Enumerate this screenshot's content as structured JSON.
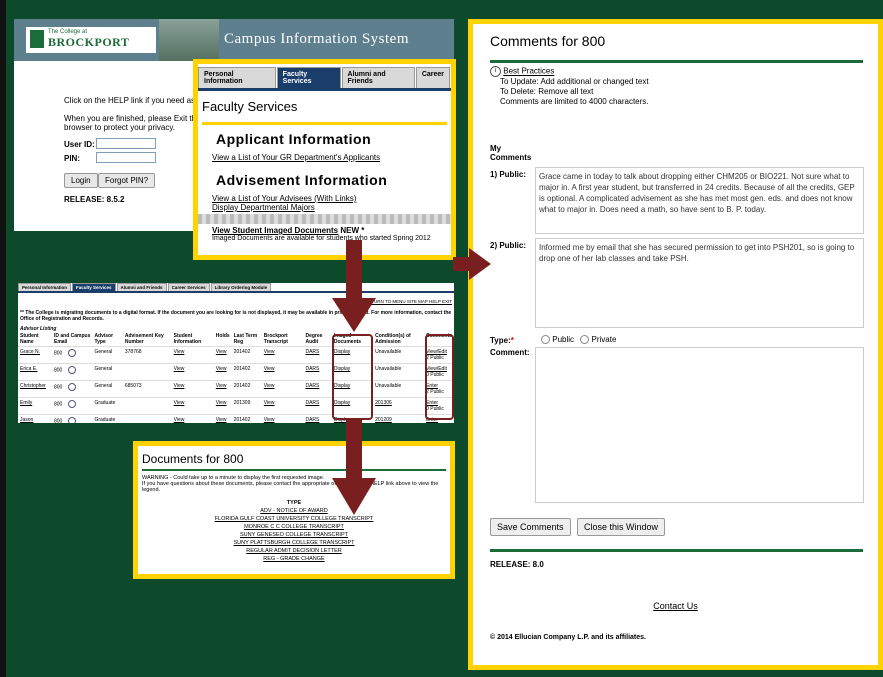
{
  "login": {
    "college_small": "The College at",
    "college_name": "BROCKPORT",
    "system_name": "Campus Information System",
    "help_line": "Click on the HELP link if you need assista",
    "exit_line1": "When you are finished, please Exit the sy",
    "exit_line2": "browser to protect your privacy.",
    "userid_label": "User ID:",
    "pin_label": "PIN:",
    "login_button": "Login",
    "forgot_button": "Forgot PIN?",
    "release": "RELEASE: 8.5.2"
  },
  "faculty": {
    "tabs": [
      "Personal Information",
      "Faculty Services",
      "Alumni and Friends",
      "Career"
    ],
    "title": "Faculty Services",
    "applicant_heading": "Applicant Information",
    "applicant_link": "View a List of Your GR Department's Applicants",
    "advisement_heading": "Advisement Information",
    "advisees_link": "View a List of Your Advisees (With Links)",
    "majors_link": "Display Departmental Majors",
    "imaged_link": "View Student Imaged Documents",
    "new_tag": "NEW *",
    "imaged_note": "Imaged Documents are available for students who started Spring 2012"
  },
  "advisees": {
    "tabs": [
      "Personal Information",
      "Faculty Services",
      "Alumni and Friends",
      "Career Services",
      "Library Ordering Module"
    ],
    "toplinks": "RETURN TO MENU   SITE MAP   HELP   EXIT",
    "notice": "** The College is migrating documents to a digital format. If the document you are looking for is not displayed, it may be available in printed format. For more information, contact the Office of Registration and Records.",
    "listing_title": "Advisor Listing",
    "headers": [
      "Student Name",
      "ID and Campus Email",
      "Advisor Type",
      "Advisement Key Number",
      "Student Information",
      "Holds",
      "Last Term Reg",
      "Brockport Transcript",
      "Degree Audit",
      "Imaged Documents",
      "Condition(s) of Admission",
      "Comments"
    ],
    "rows": [
      {
        "name": "Grace N.",
        "id": "800",
        "type": "General",
        "key": "378768",
        "info": "View",
        "holds": "View",
        "term": "201402",
        "trans": "View",
        "audit": "DARS",
        "docs": "Display",
        "cond": "Unavailable",
        "comm": "View/Edit",
        "comm2": "2 Public"
      },
      {
        "name": "Erica E.",
        "id": "800",
        "type": "General",
        "key": "",
        "info": "View",
        "holds": "View",
        "term": "201402",
        "trans": "View",
        "audit": "DARS",
        "docs": "Display",
        "cond": "Unavailable",
        "comm": "View/Edit",
        "comm2": "0 Public"
      },
      {
        "name": "Christopher",
        "id": "800",
        "type": "General",
        "key": "685073",
        "info": "View",
        "holds": "View",
        "term": "201402",
        "trans": "View",
        "audit": "DARS",
        "docs": "Display",
        "cond": "Unavailable",
        "comm": "Enter",
        "comm2": "2 Public"
      },
      {
        "name": "Emily",
        "id": "800",
        "type": "Graduate",
        "key": "",
        "info": "View",
        "holds": "View",
        "term": "201309",
        "trans": "View",
        "audit": "DARS",
        "docs": "Display",
        "cond": "201306",
        "comm": "Enter",
        "comm2": "0 Public"
      },
      {
        "name": "Jason",
        "id": "800",
        "type": "Graduate",
        "key": "",
        "info": "View",
        "holds": "View",
        "term": "201402",
        "trans": "View",
        "audit": "DARS",
        "docs": "Display",
        "cond": "201209",
        "comm": "Enter",
        "comm2": "0 Public"
      }
    ]
  },
  "documents": {
    "title": "Documents for 800",
    "warning1": "WARNING - Could take up to a minute to display the first requested image.",
    "warning2": "If you have questions about these documents, please contact the appropriate office. Click the HELP link above to view the legend.",
    "type_header": "TYPE",
    "items": [
      "ADV - NOTICE OF AWARD",
      "FLORIDA GULF COAST UNIVERSITY COLLEGE TRANSCRIPT",
      "MONROE C C COLLEGE TRANSCRIPT",
      "SUNY GENESEO COLLEGE TRANSCRIPT",
      "SUNY PLATTSBURGH COLLEGE TRANSCRIPT",
      "REGULAR ADMIT DECISION LETTER",
      "REG - GRADE CHANGE"
    ]
  },
  "comments": {
    "title": "Comments for 800",
    "best_practices": "Best Practices",
    "update_line": "To Update: Add additional or changed text",
    "delete_line": "To Delete: Remove all text",
    "limit_line": "Comments are limited to 4000 characters.",
    "my_comments": "My Comments",
    "c1_label": "1) Public:",
    "c1_text": "Grace came in today to talk about dropping either CHM205 or BIO221.  Not sure what to major in.  A first year student, but transferred in 24 credits. Because of all the credits, GEP is optional.  A complicated advisement as she has met most gen. eds. and does not know what to major in.  Does need a math, so have sent to B. P. today.",
    "c2_label": "2) Public:",
    "c2_text": "Informed me by email that she has secured permission to get into PSH201, so is going to drop one of her lab classes and take PSH.",
    "type_label": "Type:",
    "public_option": "Public",
    "private_option": "Private",
    "comment_label": "Comment:",
    "save_button": "Save Comments",
    "close_button": "Close this Window",
    "release": "RELEASE: 8.0",
    "contact": "Contact Us",
    "copyright": "© 2014 Ellucian Company L.P. and its affiliates."
  },
  "colors": {
    "background": "#0d4a2c",
    "frame": "#ffd200",
    "arrow": "#7a1f1f"
  }
}
